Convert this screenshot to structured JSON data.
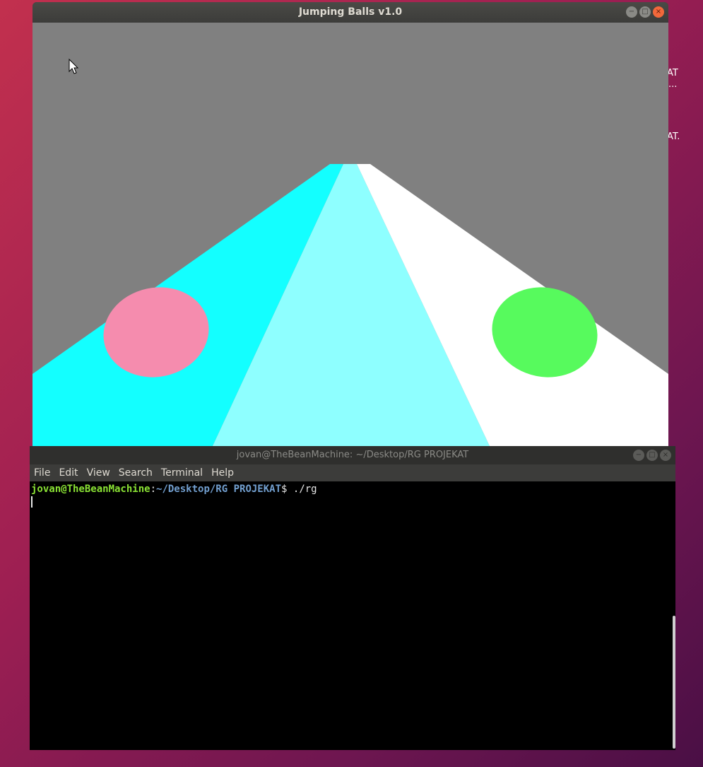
{
  "game_window": {
    "title": "Jumping Balls v1.0",
    "controls": {
      "minimize": "−",
      "maximize": "□",
      "close": "×"
    },
    "scene": {
      "sky_color": "#808080",
      "lanes": {
        "left_color": "#13ffff",
        "center_color": "#8effff",
        "right_color": "#ffffff"
      },
      "balls": [
        {
          "color": "#f58cae",
          "lane": "left"
        },
        {
          "color": "#57fa5d",
          "lane": "right"
        }
      ]
    }
  },
  "desktop": {
    "label_1": "AT",
    "label_2": "...",
    "label_3": "AT."
  },
  "terminal": {
    "title": "jovan@TheBeanMachine: ~/Desktop/RG PROJEKAT",
    "menu": [
      "File",
      "Edit",
      "View",
      "Search",
      "Terminal",
      "Help"
    ],
    "prompt_user": "jovan@TheBeanMachine",
    "prompt_sep": ":",
    "prompt_path": "~/Desktop/RG PROJEKAT",
    "prompt_symbol": "$ ",
    "command": "./rg"
  }
}
